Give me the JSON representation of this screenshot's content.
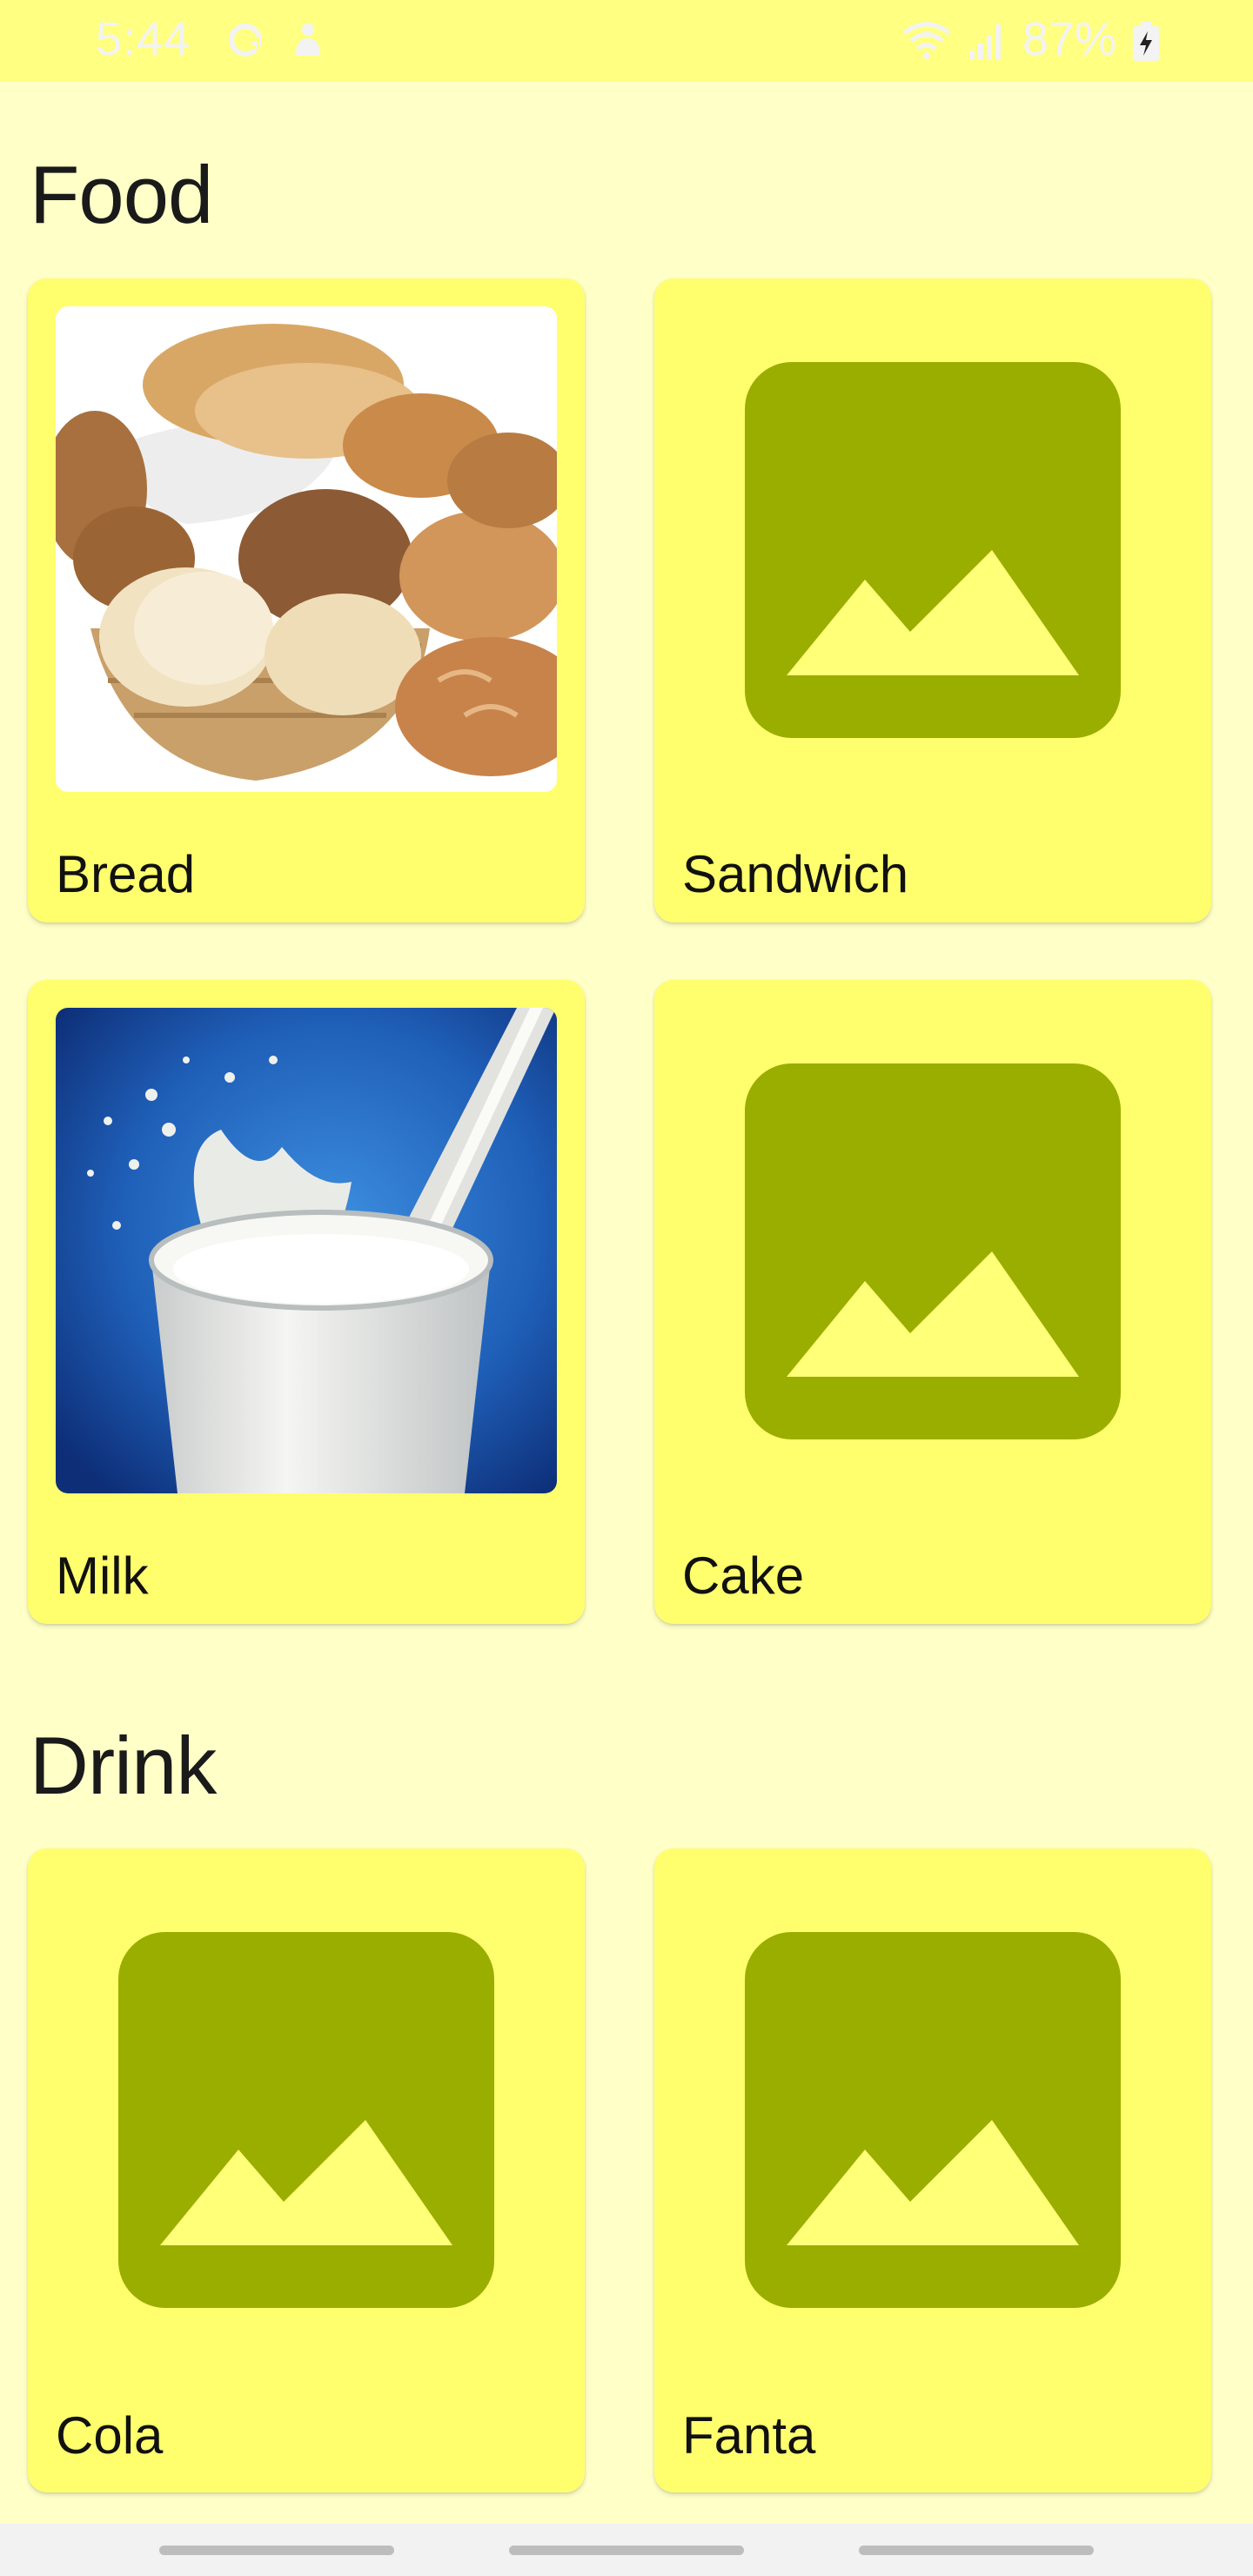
{
  "status_bar": {
    "time": "5:44",
    "battery": "87%",
    "icons": [
      "sync-icon",
      "notification-icon",
      "wifi-icon",
      "signal-icon",
      "battery-charging-icon"
    ]
  },
  "sections": [
    {
      "title": "Food",
      "items": [
        {
          "label": "Bread",
          "image": "bread-photo"
        },
        {
          "label": "Sandwich",
          "image": "image-placeholder-icon"
        },
        {
          "label": "Milk",
          "image": "milk-photo"
        },
        {
          "label": "Cake",
          "image": "image-placeholder-icon"
        }
      ]
    },
    {
      "title": "Drink",
      "items": [
        {
          "label": "Cola",
          "image": "image-placeholder-icon"
        },
        {
          "label": "Fanta",
          "image": "image-placeholder-icon"
        }
      ]
    }
  ],
  "colors": {
    "background": "#FFFFC8",
    "status_bar": "#FFFF82",
    "card": "#FFFF6E",
    "placeholder": "#9AAE00",
    "placeholder_mountains": "#FFFF78"
  }
}
